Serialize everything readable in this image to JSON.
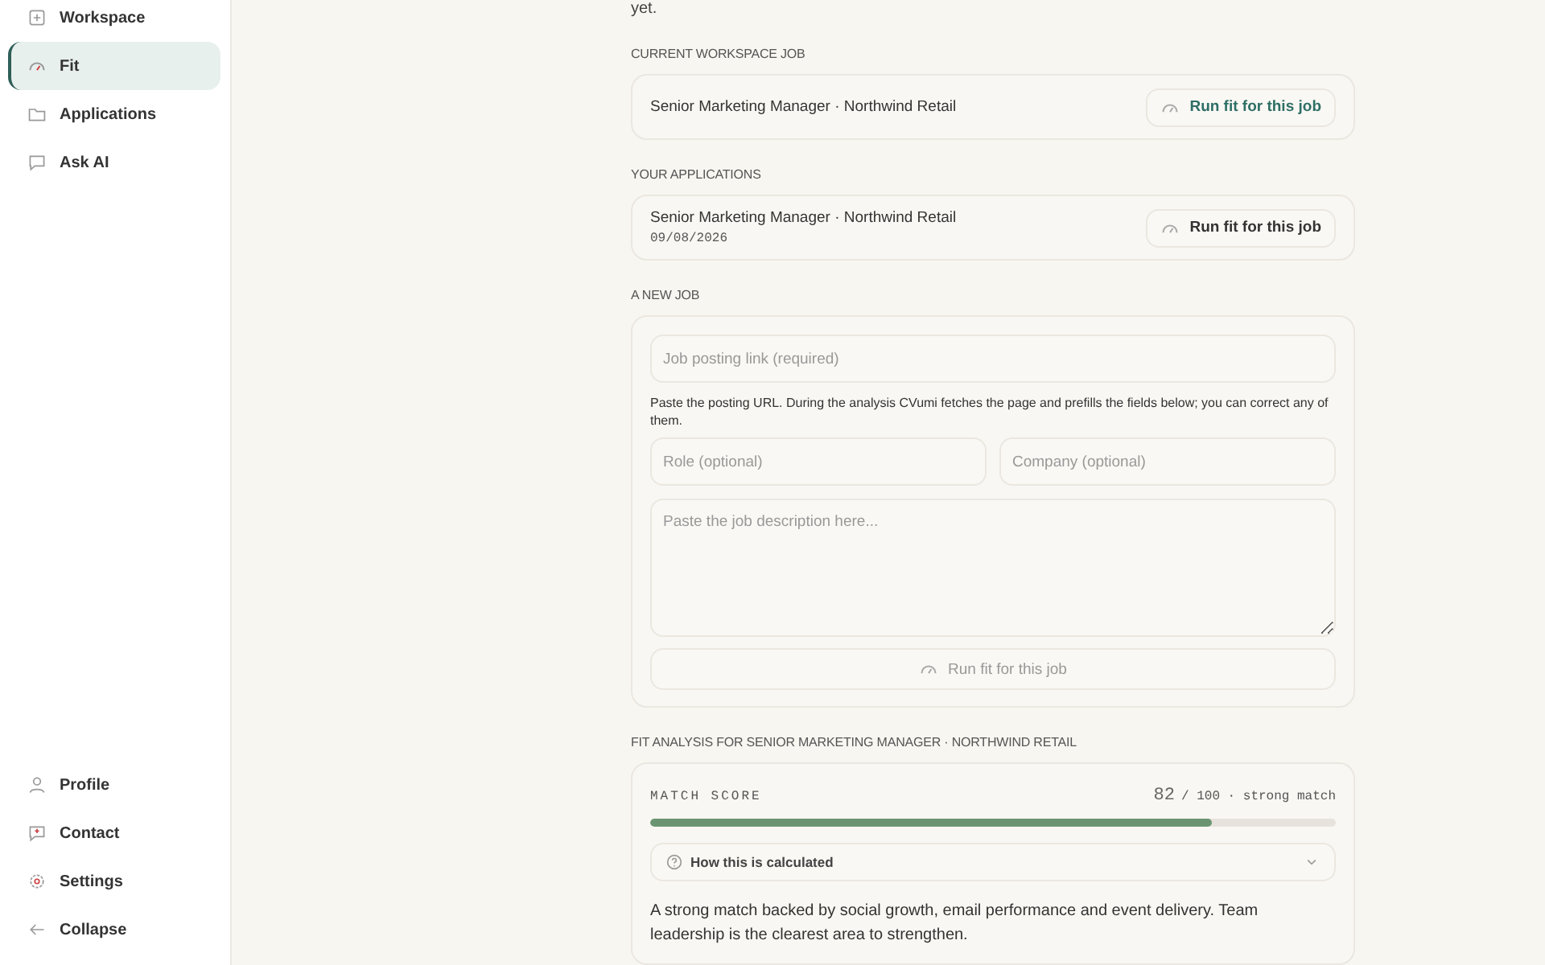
{
  "sidebar": {
    "top_items": [
      {
        "label": "Workspace",
        "selected": false
      },
      {
        "label": "Fit",
        "selected": true
      },
      {
        "label": "Applications",
        "selected": false
      },
      {
        "label": "Ask AI",
        "selected": false
      }
    ],
    "bottom_items": [
      {
        "label": "Profile"
      },
      {
        "label": "Contact"
      },
      {
        "label": "Settings"
      },
      {
        "label": "Collapse"
      }
    ]
  },
  "intro_tail": "yet.",
  "workspace_job": {
    "label": "CURRENT WORKSPACE JOB",
    "title": "Senior Marketing Manager · Northwind Retail",
    "button": {
      "label": "Run fit for this job",
      "kind": "accent"
    }
  },
  "applications": {
    "label": "YOUR APPLICATIONS",
    "items": [
      {
        "title": "Senior Marketing Manager · Northwind Retail",
        "date": "09/08/2026",
        "button": {
          "label": "Run fit for this job",
          "kind": "plain"
        }
      }
    ]
  },
  "new_job": {
    "label": "A NEW JOB",
    "link_placeholder": "Job posting link (required)",
    "hint": "Paste the posting URL. During the analysis CVumi fetches the page and prefills the fields below; you can correct any of them.",
    "role_placeholder": "Role (optional)",
    "company_placeholder": "Company (optional)",
    "description_placeholder": "Paste the job description here...",
    "button": {
      "label": "Run fit for this job",
      "disabled": true
    }
  },
  "analysis": {
    "label": "FIT ANALYSIS FOR SENIOR MARKETING MANAGER · NORTHWIND RETAIL",
    "score_label": "MATCH SCORE",
    "score": "82",
    "score_suffix": "/ 100 · strong match",
    "level": 0.82,
    "explainer": {
      "label": "How this is calculated",
      "expanded": false
    },
    "summary": "A strong match backed by social growth, email performance and event delivery. Team leadership is the clearest area to strengthen."
  }
}
